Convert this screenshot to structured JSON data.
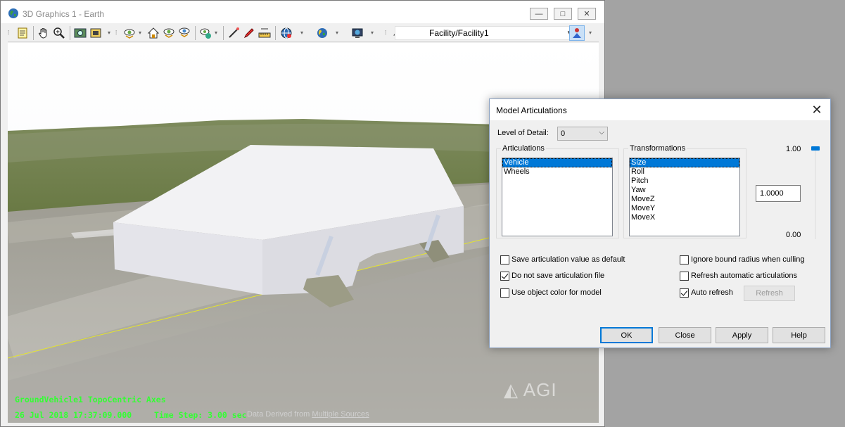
{
  "window": {
    "title": "3D Graphics 1 - Earth",
    "controls": {
      "minimize": "—",
      "restore": "□",
      "close": "✕"
    }
  },
  "toolbar": {
    "icons": [
      "properties-icon",
      "pan-hand-icon",
      "zoom-icon",
      "snapshot-icon",
      "record-icon",
      "view-from-icon",
      "home-view-icon",
      "view-target-icon",
      "view-orientation-icon",
      "measure-icon",
      "pen-icon",
      "marker-icon",
      "ruler-icon",
      "globe-icon",
      "earth-icon",
      "map-icon",
      "object-icon",
      "object-disabled-icon",
      "facility-user-icon"
    ],
    "facility_select": "Facility/Facility1"
  },
  "viewport": {
    "bing_logo": "bing",
    "agi_logo": "AGI",
    "vehicle_axes_label": "GroundVehicle1 TopoCentric Axes",
    "datetime": "26 Jul 2018 17:37:09.000",
    "time_step": "Time Step: 3.00 sec",
    "credit_prefix": "Data Derived from ",
    "credit_link": "Multiple Sources"
  },
  "dialog": {
    "title": "Model Articulations",
    "close_glyph": "✕",
    "level_of_detail_label": "Level of Detail:",
    "level_of_detail_value": "0",
    "articulations_label": "Articulations",
    "articulations": [
      {
        "label": "Vehicle",
        "selected": true
      },
      {
        "label": "Wheels",
        "selected": false
      }
    ],
    "transformations_label": "Transformations",
    "transformations": [
      {
        "label": "Size",
        "selected": true
      },
      {
        "label": "Roll",
        "selected": false
      },
      {
        "label": "Pitch",
        "selected": false
      },
      {
        "label": "Yaw",
        "selected": false
      },
      {
        "label": "MoveZ",
        "selected": false
      },
      {
        "label": "MoveY",
        "selected": false
      },
      {
        "label": "MoveX",
        "selected": false
      }
    ],
    "slider_max": "1.00",
    "slider_min": "0.00",
    "slider_level": 1.0,
    "value": "1.0000",
    "options": {
      "save_default": {
        "label": "Save articulation value as default",
        "checked": false
      },
      "no_save_file": {
        "label": "Do not save articulation file",
        "checked": true
      },
      "object_color": {
        "label": "Use object color for model",
        "checked": false
      },
      "ignore_bound": {
        "label": "Ignore bound radius when culling",
        "checked": false
      },
      "refresh_auto": {
        "label": "Refresh automatic articulations",
        "checked": false
      },
      "auto_refresh": {
        "label": "Auto refresh",
        "checked": true
      }
    },
    "buttons": {
      "refresh": "Refresh",
      "ok": "OK",
      "close": "Close",
      "apply": "Apply",
      "help": "Help"
    }
  },
  "colors": {
    "accent": "#0078d7",
    "overlay_text": "#33ff33"
  }
}
